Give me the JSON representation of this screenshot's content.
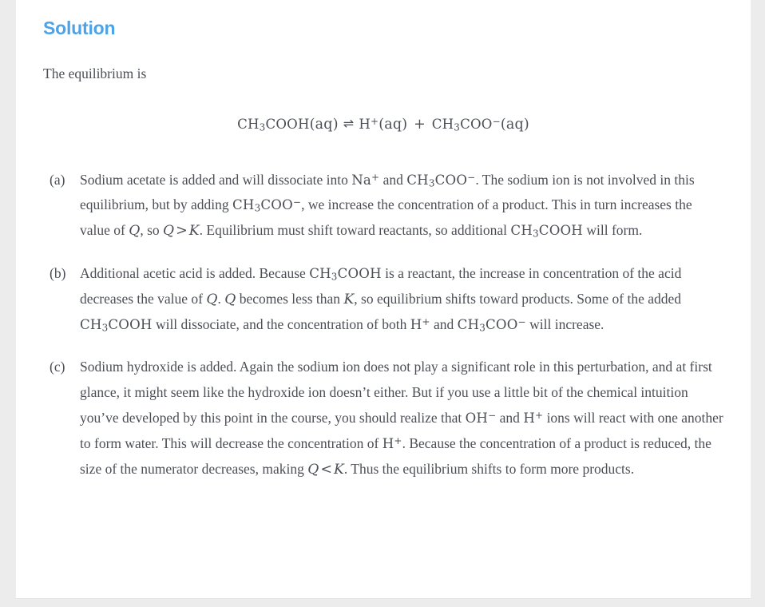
{
  "page": {
    "background_color": "#ececec",
    "card_background": "#ffffff"
  },
  "solution": {
    "heading": "Solution",
    "heading_color": "#4da3e8",
    "intro": "The equilibrium is",
    "equation": {
      "reactant": "CH3COOH(aq)",
      "arrow": "⇌",
      "products": "H+(aq) + CH3COO−(aq)",
      "plain_text": "CH3COOH(aq) ⇌ H+(aq) + CH3COO−(aq)"
    },
    "parts": [
      {
        "label": "(a)",
        "text": "Sodium acetate is added and will dissociate into Na+ and CH3COO−. The sodium ion is not involved in this equilibrium, but by adding CH3COO−, we increase the concentration of a product. This in turn increases the value of Q, so Q > K. Equilibrium must shift toward reactants, so additional CH3COOH will form.",
        "segments": [
          {
            "type": "text",
            "value": "Sodium acetate is added and will dissociate into "
          },
          {
            "type": "chem",
            "value": "Na+"
          },
          {
            "type": "text",
            "value": " and "
          },
          {
            "type": "chem",
            "value": "CH3COO−"
          },
          {
            "type": "text",
            "value": ". The sodium ion is not involved in this equilibrium, but by adding "
          },
          {
            "type": "chem",
            "value": "CH3COO−"
          },
          {
            "type": "text",
            "value": ", we increase the concentration of a product. This in turn increases the value of "
          },
          {
            "type": "var",
            "value": "Q"
          },
          {
            "type": "text",
            "value": ", so "
          },
          {
            "type": "var",
            "value": "Q"
          },
          {
            "type": "rel",
            "value": ">"
          },
          {
            "type": "var",
            "value": "K"
          },
          {
            "type": "text",
            "value": ". Equilibrium must shift toward reactants, so additional "
          },
          {
            "type": "chem",
            "value": "CH3COOH"
          },
          {
            "type": "text",
            "value": " will form."
          }
        ]
      },
      {
        "label": "(b)",
        "text": "Additional acetic acid is added. Because CH3COOH is a reactant, the increase in concentration of the acid decreases the value of Q. Q becomes less than K, so equilibrium shifts toward products. Some of the added CH3COOH will dissociate, and the concentration of both H+ and CH3COO− will increase.",
        "segments": [
          {
            "type": "text",
            "value": "Additional acetic acid is added. Because "
          },
          {
            "type": "chem",
            "value": "CH3COOH"
          },
          {
            "type": "text",
            "value": " is a reactant, the increase in concentration of the acid decreases the value of "
          },
          {
            "type": "var",
            "value": "Q"
          },
          {
            "type": "text",
            "value": ". "
          },
          {
            "type": "var",
            "value": "Q"
          },
          {
            "type": "text",
            "value": " becomes less than "
          },
          {
            "type": "var",
            "value": "K"
          },
          {
            "type": "text",
            "value": ", so equilibrium shifts toward products. Some of the added "
          },
          {
            "type": "chem",
            "value": "CH3COOH"
          },
          {
            "type": "text",
            "value": " will dissociate, and the concentration of both "
          },
          {
            "type": "chem",
            "value": "H+"
          },
          {
            "type": "text",
            "value": " and "
          },
          {
            "type": "chem",
            "value": "CH3COO−"
          },
          {
            "type": "text",
            "value": " will increase."
          }
        ]
      },
      {
        "label": "(c)",
        "text": "Sodium hydroxide is added. Again the sodium ion does not play a significant role in this perturbation, and at first glance, it might seem like the hydroxide ion doesn’t either. But if you use a little bit of the chemical intuition you’ve developed by this point in the course, you should realize that OH− and H+ ions will react with one another to form water. This will decrease the concentration of H+. Because the concentration of a product is reduced, the size of the numerator decreases, making Q < K. Thus the equilibrium shifts to form more products.",
        "segments": [
          {
            "type": "text",
            "value": "Sodium hydroxide is added. Again the sodium ion does not play a significant role in this perturbation, and at first glance, it might seem like the hydroxide ion doesn’t either. But if you use a little bit of the chemical intuition you’ve developed by this point in the course, you should realize that "
          },
          {
            "type": "chem",
            "value": "OH−"
          },
          {
            "type": "text",
            "value": " and "
          },
          {
            "type": "chem",
            "value": "H+"
          },
          {
            "type": "text",
            "value": " ions will react with one another to form water. This will decrease the concentration of "
          },
          {
            "type": "chem",
            "value": "H+"
          },
          {
            "type": "text",
            "value": ". Because the concentration of a product is reduced, the size of the numerator decreases, making "
          },
          {
            "type": "var",
            "value": "Q"
          },
          {
            "type": "rel",
            "value": "<"
          },
          {
            "type": "var",
            "value": "K"
          },
          {
            "type": "text",
            "value": ". Thus the equilibrium shifts to form more products."
          }
        ]
      }
    ]
  }
}
